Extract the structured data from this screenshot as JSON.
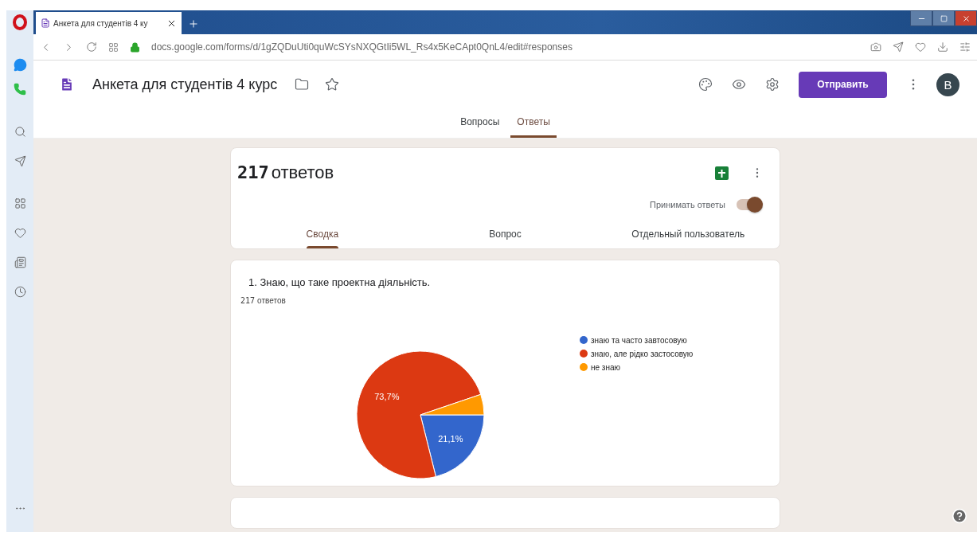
{
  "browser": {
    "tab_title": "Анкета для студентів 4 ку",
    "url": "docs.google.com/forms/d/1gZQDuUti0quWcSYsNXQGtIi5WL_Rs4x5KeCApt0QnL4/edit#responses"
  },
  "form": {
    "title": "Анкета для студентів 4 курс",
    "send_button": "Отправить",
    "avatar": "B",
    "tabs": [
      {
        "label": "Вопросы",
        "selected": false
      },
      {
        "label": "Ответы",
        "selected": true
      }
    ]
  },
  "responses": {
    "count": "217",
    "count_label": "ответов",
    "accepting": {
      "label": "Принимать ответы",
      "on": true
    },
    "view_tabs": [
      {
        "label": "Сводка",
        "selected": true
      },
      {
        "label": "Вопрос",
        "selected": false
      },
      {
        "label": "Отдельный пользователь",
        "selected": false
      }
    ]
  },
  "question": {
    "title": "1. Знаю, що таке проектна діяльність.",
    "count": "217",
    "count_label": "ответов",
    "chart_data": {
      "type": "pie",
      "categories": [
        "знаю та часто завтосовую",
        "знаю, але рідко застосовую",
        "не знаю"
      ],
      "colors": [
        "#3366cc",
        "#dc3912",
        "#ff9900"
      ],
      "values": [
        21.1,
        73.7,
        5.2
      ],
      "legend": true,
      "value_labels": [
        "21,1%",
        "73,7%",
        null
      ]
    }
  }
}
